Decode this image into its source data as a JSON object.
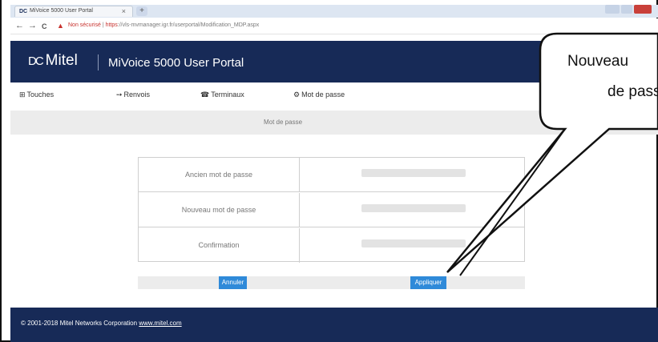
{
  "browser": {
    "tab_title": "MiVoice 5000 User Portal",
    "tab_favicon": "DC",
    "tab_close": "×",
    "new_tab": "+",
    "back": "←",
    "forward": "→",
    "reload": "C",
    "security_warning": "Non sécurisé",
    "url_https": "https",
    "url_host": "://vls-mvmanager.igr.fr",
    "url_path": "/userportal/Modification_MDP.aspx"
  },
  "header": {
    "brand_mark": "DC",
    "brand_name": "Mitel",
    "title": "MiVoice 5000 User Portal"
  },
  "nav": {
    "items": [
      {
        "icon": "⊞",
        "label": "Touches"
      },
      {
        "icon": "➙",
        "label": "Renvois"
      },
      {
        "icon": "☎",
        "label": "Terminaux"
      },
      {
        "icon": "⚙",
        "label": "Mot de passe"
      }
    ]
  },
  "section": {
    "title": "Mot de passe"
  },
  "form": {
    "rows": [
      {
        "label": "Ancien mot de passe",
        "value": ""
      },
      {
        "label": "Nouveau mot de passe",
        "value": ""
      },
      {
        "label": "Confirmation",
        "value": ""
      }
    ]
  },
  "buttons": {
    "cancel": "Annuler",
    "apply": "Appliquer"
  },
  "footer": {
    "copyright": "© 2001-2018 Mitel Networks Corporation",
    "link": "www.mitel.com"
  },
  "callout": {
    "line1": "Nouveau",
    "line2": "de pass"
  },
  "colors": {
    "header_bg": "#172a57",
    "button_bg": "#2f8ad9",
    "warning": "#c8322e"
  }
}
